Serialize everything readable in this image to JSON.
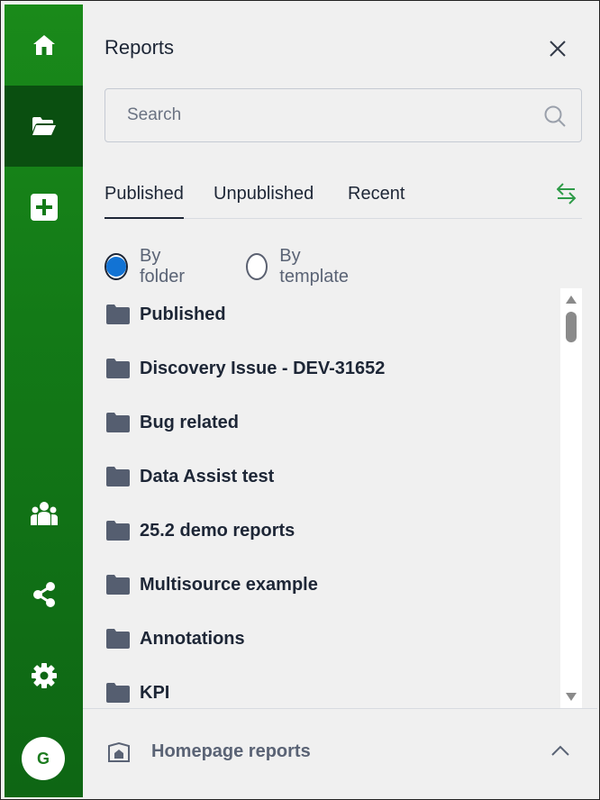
{
  "panel": {
    "title": "Reports",
    "search_placeholder": "Search"
  },
  "tabs": [
    {
      "label": "Published",
      "active": true
    },
    {
      "label": "Unpublished",
      "active": false
    },
    {
      "label": "Recent",
      "active": false
    }
  ],
  "view_options": [
    {
      "label": "By folder",
      "selected": true
    },
    {
      "label": "By template",
      "selected": false
    }
  ],
  "folders": [
    "Published",
    "Discovery Issue - DEV-31652",
    "Bug related",
    "Data Assist test",
    "25.2 demo reports",
    "Multisource example",
    "Annotations",
    "KPI"
  ],
  "footer": {
    "label": "Homepage reports"
  },
  "user": {
    "initial": "G"
  },
  "colors": {
    "rail_green": "#137a17",
    "rail_active": "#0a4f10",
    "text_dark": "#1d2636",
    "radio_selected": "#1273d4",
    "swap_icon_green": "#2e9b48",
    "folder_icon": "#555e70"
  }
}
